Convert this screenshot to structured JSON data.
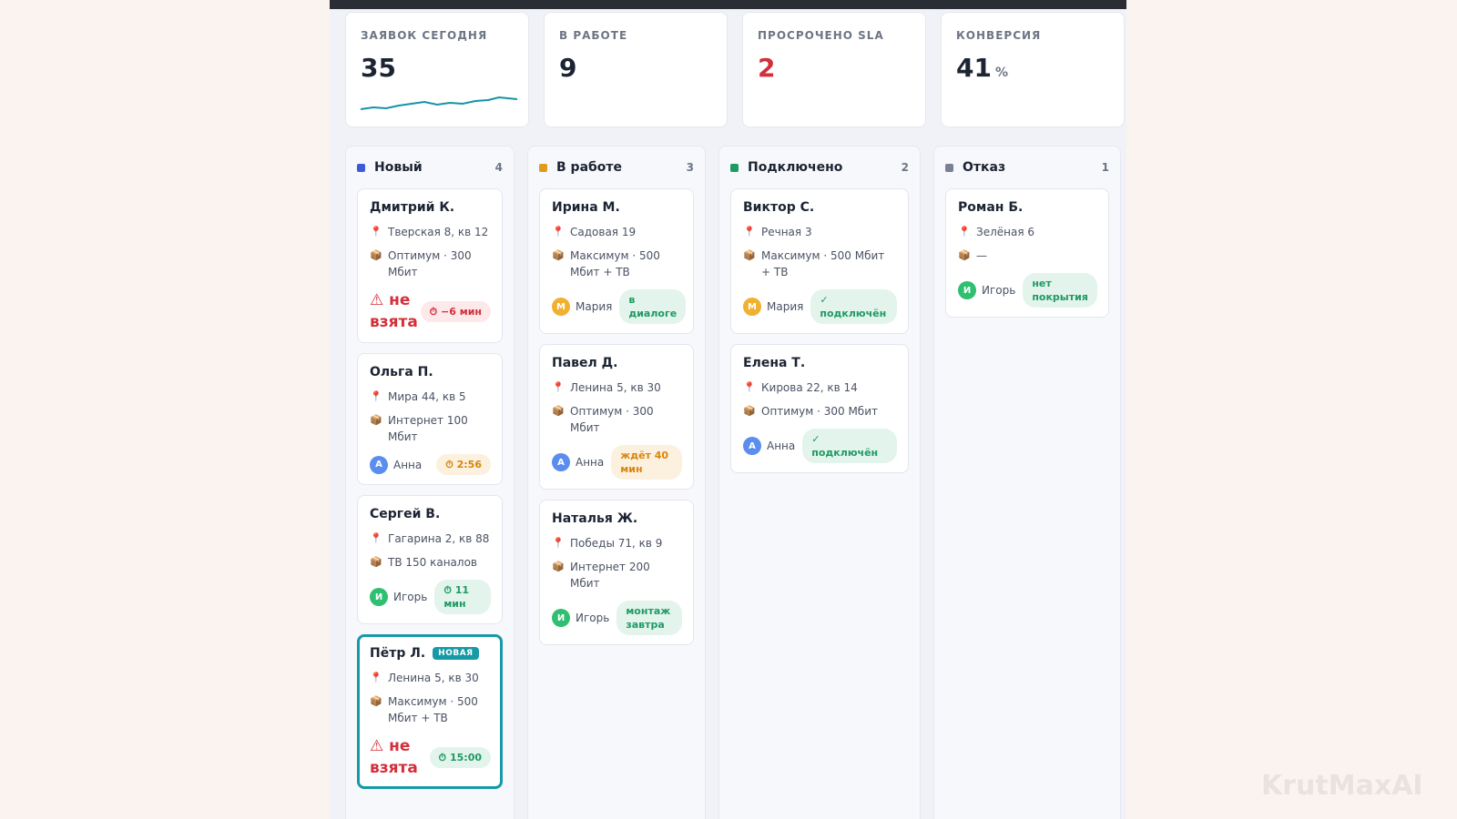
{
  "kpis": [
    {
      "label": "ЗАЯВОК СЕГОДНЯ",
      "value": "35"
    },
    {
      "label": "В РАБОТЕ",
      "value": "9"
    },
    {
      "label": "ПРОСРОЧЕНО SLA",
      "value": "2"
    },
    {
      "label": "КОНВЕРСИЯ",
      "value": "41",
      "unit": "%"
    }
  ],
  "columns": [
    {
      "title": "Новый",
      "count": "4",
      "color": "#3b5bdb"
    },
    {
      "title": "В работе",
      "count": "3",
      "color": "#e09b1e"
    },
    {
      "title": "Подключено",
      "count": "2",
      "color": "#1f9a63"
    },
    {
      "title": "Отказ",
      "count": "1",
      "color": "#7a8194"
    }
  ],
  "icons": {
    "address": "📍",
    "package": "📦",
    "warning": "⚠",
    "clock": "⏱",
    "check": "✓"
  },
  "colors": {
    "avatar_anna": "#5b8def",
    "avatar_maria": "#f0b030",
    "avatar_igor": "#2fbf71",
    "accent": "#159aa6"
  },
  "cards": {
    "dmitry": {
      "name": "Дмитрий К.",
      "address": "Тверская 8, кв 12",
      "plan": "Оптимум · 300 Мбит",
      "warn": "не взята",
      "pill": "−6 мин"
    },
    "olga": {
      "name": "Ольга П.",
      "address": "Мира 44, кв 5",
      "plan": "Интернет 100 Мбит",
      "avatar": "А",
      "assignee": "Анна",
      "pill": "2:56"
    },
    "sergey": {
      "name": "Сергей В.",
      "address": "Гагарина 2, кв 88",
      "plan": "ТВ 150 каналов",
      "avatar": "И",
      "assignee": "Игорь",
      "pill": "11 мин"
    },
    "petr": {
      "name": "Пётр Л.",
      "badge": "НОВАЯ",
      "address": "Ленина 5, кв 30",
      "plan": "Максимум · 500 Мбит + ТВ",
      "warn": "не взята",
      "pill": "15:00"
    },
    "irina": {
      "name": "Ирина М.",
      "address": "Садовая 19",
      "plan": "Максимум · 500 Мбит + ТВ",
      "avatar": "М",
      "assignee": "Мария",
      "pill": "в диалоге"
    },
    "pavel": {
      "name": "Павел Д.",
      "address": "Ленина 5, кв 30",
      "plan": "Оптимум · 300 Мбит",
      "avatar": "А",
      "assignee": "Анна",
      "pill": "ждёт 40 мин"
    },
    "natalia": {
      "name": "Наталья Ж.",
      "address": "Победы 71, кв 9",
      "plan": "Интернет 200 Мбит",
      "avatar": "И",
      "assignee": "Игорь",
      "pill": "монтаж завтра"
    },
    "viktor": {
      "name": "Виктор С.",
      "address": "Речная 3",
      "plan": "Максимум · 500 Мбит + ТВ",
      "avatar": "М",
      "assignee": "Мария",
      "pill": "подключён"
    },
    "elena": {
      "name": "Елена Т.",
      "address": "Кирова 22, кв 14",
      "plan": "Оптимум · 300 Мбит",
      "avatar": "А",
      "assignee": "Анна",
      "pill": "подключён"
    },
    "roman": {
      "name": "Роман Б.",
      "address": "Зелёная 6",
      "plan": "—",
      "avatar": "И",
      "assignee": "Игорь",
      "pill": "нет покрытия"
    }
  },
  "watermark": "KrutMaxAI"
}
